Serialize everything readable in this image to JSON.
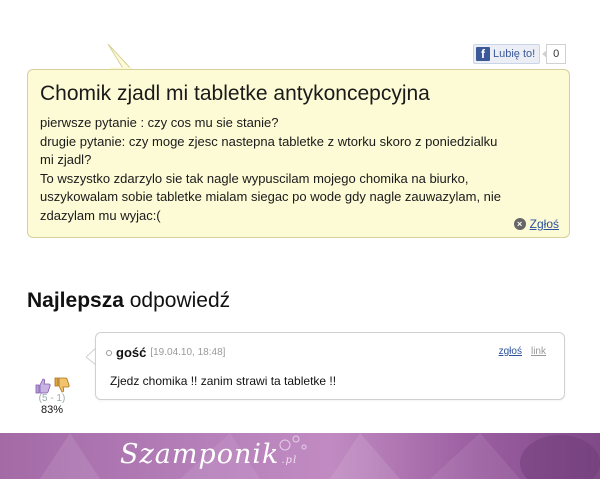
{
  "like": {
    "label": "Lubię to!",
    "count": "0",
    "fb_glyph": "f"
  },
  "question": {
    "title": "Chomik zjadl mi tabletke antykoncepcyjna",
    "lines": [
      "pierwsze pytanie : czy cos mu sie stanie?",
      "drugie pytanie: czy moge zjesc nastepna tabletke z wtorku skoro z poniedzialku",
      "mi zjadl?",
      "To wszystko zdarzylo sie tak nagle wypuscilam mojego chomika na biurko,",
      "uszykowalam sobie tabletke mialam siegac po wode gdy nagle zauwazylam, nie",
      "zdazylam mu wyjac:("
    ],
    "report_label": "Zgłoś"
  },
  "best_answer": {
    "heading_bold": "Najlepsza",
    "heading_rest": "odpowiedź"
  },
  "answer": {
    "author": "gość",
    "date": "[19.04.10, 18:48]",
    "report_label": "zgłoś",
    "link_label": "link",
    "text": "Zjedz chomika !! zanim strawi ta tabletke !!"
  },
  "votes": {
    "ratio": "(5 - 1)",
    "percent": "83%"
  },
  "banner": {
    "logo": "Szamponik",
    "tld": ".pl"
  },
  "colors": {
    "question_bg": "#fdfbd6",
    "link": "#2a4f9c",
    "facebook": "#3b5998",
    "banner": "#b37db8"
  }
}
